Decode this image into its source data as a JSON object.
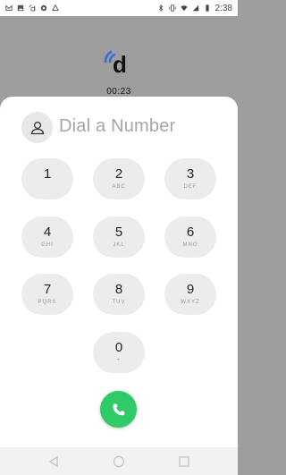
{
  "status_bar": {
    "time": "2:38",
    "left_icons": [
      "gmail-icon",
      "image-icon",
      "dialpad-app-icon",
      "settings-icon",
      "drive-icon"
    ],
    "right_icons": [
      "bluetooth-icon",
      "vibrate-icon",
      "wifi-icon",
      "signal-icon",
      "battery-icon"
    ]
  },
  "call": {
    "logo_letter": "d",
    "timer": "00:23"
  },
  "dialer": {
    "title": "Dial a Number",
    "keys": [
      {
        "digit": "1",
        "letters": ""
      },
      {
        "digit": "2",
        "letters": "ABC"
      },
      {
        "digit": "3",
        "letters": "DEF"
      },
      {
        "digit": "4",
        "letters": "GHI"
      },
      {
        "digit": "5",
        "letters": "JKL"
      },
      {
        "digit": "6",
        "letters": "MNO"
      },
      {
        "digit": "7",
        "letters": "PQRS"
      },
      {
        "digit": "8",
        "letters": "TUV"
      },
      {
        "digit": "9",
        "letters": "WXYZ"
      },
      {
        "digit": "0",
        "letters": "+"
      }
    ]
  },
  "colors": {
    "call_green": "#2fcb66",
    "logo_blue": "#3b6fd6",
    "overlay_gray": "#9e9e9e"
  }
}
